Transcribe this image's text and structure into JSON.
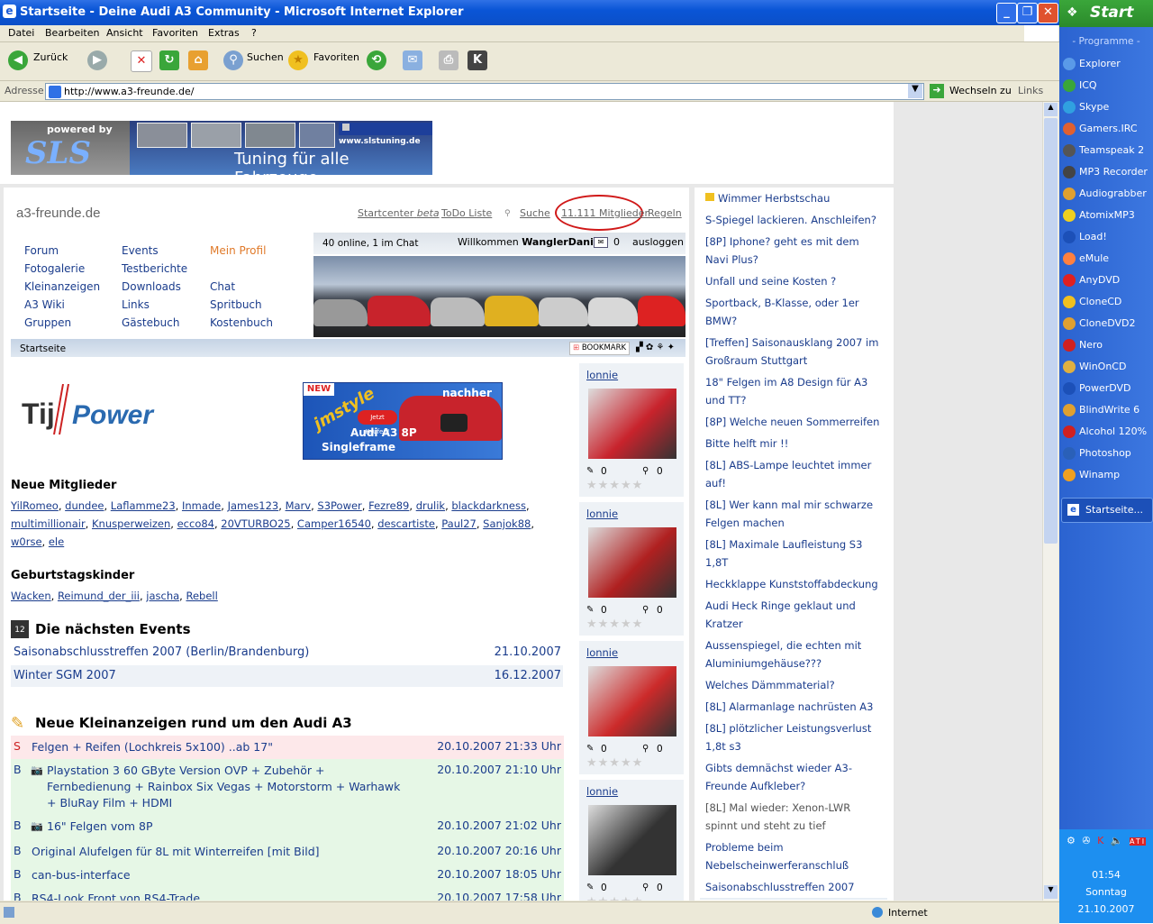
{
  "window": {
    "title": "Startseite - Deine Audi A3 Community - Microsoft Internet Explorer",
    "minimize_label": "_",
    "maximize_label": "❐",
    "close_label": "✕"
  },
  "menubar": [
    "Datei",
    "Bearbeiten",
    "Ansicht",
    "Favoriten",
    "Extras",
    "?"
  ],
  "toolbar": {
    "back_label": "Zurück",
    "search_label": "Suchen",
    "favorites_label": "Favoriten"
  },
  "address": {
    "label": "Adresse",
    "url": "http://www.a3-freunde.de/",
    "go_label": "Wechseln zu",
    "links_label": "Links"
  },
  "banner": {
    "powered_by": "powered by",
    "brand": "SLS",
    "url": "www.slstuning.de",
    "tagline": "Tuning für alle Fahrzeuge"
  },
  "site": {
    "logo": "a3-freunde.de",
    "topnav": {
      "startcenter": "Startcenter",
      "beta": "beta",
      "todo": "ToDo Liste",
      "search": "Suche",
      "members": "11.111 Mitglieder",
      "rules": "Regeln"
    },
    "menu_col1": [
      "Forum",
      "Fotogalerie",
      "Kleinanzeigen",
      "A3 Wiki",
      "Gruppen"
    ],
    "menu_col2": [
      "Events",
      "Testberichte",
      "Downloads",
      "Links",
      "Gästebuch"
    ],
    "menu_col3": [
      "Mein Profil",
      "",
      "Chat",
      "Spritbuch",
      "Kostenbuch"
    ],
    "online": "40 online, 1 im Chat",
    "welcome": "Willkommen",
    "username": "WanglerDaniel",
    "msg_count": "0",
    "logout": "ausloggen",
    "breadcrumb": "Startseite",
    "bookmark": "BOOKMARK"
  },
  "ads": {
    "tijpower": "Tij Power",
    "audi_new": "NEW",
    "audi_style": "jmstyle",
    "audi_buy": "Jetzt Kaufen!",
    "audi_after": "nachher",
    "audi_line1": "Audi A3 8P",
    "audi_line2": "Singleframe"
  },
  "new_members": {
    "heading": "Neue Mitglieder",
    "names": [
      "YilRomeo",
      "dundee",
      "Laflamme23",
      "Inmade",
      "James123",
      "Marv",
      "S3Power",
      "Fezre89",
      "drulik",
      "blackdarkness",
      "multimillionair",
      "Knusperweizen",
      "ecco84",
      "20VTURBO25",
      "Camper16540",
      "descartiste",
      "Paul27",
      "Sanjok88",
      "w0rse",
      "ele"
    ]
  },
  "birthdays": {
    "heading": "Geburtstagskinder",
    "names": [
      "Wacken",
      "Reimund_der_iii",
      "jascha",
      "Rebell"
    ]
  },
  "events": {
    "heading": "Die nächsten Events",
    "icon_text": "12",
    "items": [
      {
        "name": "Saisonabschlusstreffen 2007 (Berlin/Brandenburg)",
        "date": "21.10.2007"
      },
      {
        "name": "Winter SGM 2007",
        "date": "16.12.2007"
      }
    ]
  },
  "classifieds": {
    "heading": "Neue Kleinanzeigen rund um den Audi A3",
    "items": [
      {
        "type": "S",
        "title": "Felgen + Reifen (Lochkreis 5x100) ..ab 17\"",
        "date": "20.10.2007 21:33 Uhr",
        "camera": false
      },
      {
        "type": "B",
        "title": "Playstation 3 60 GByte Version OVP + Zubehör + Fernbedienung + Rainbox Six Vegas + Motorstorm + Warhawk + BluRay Film + HDMI",
        "date": "20.10.2007 21:10 Uhr",
        "camera": true
      },
      {
        "type": "B",
        "title": "16\" Felgen vom 8P",
        "date": "20.10.2007 21:02 Uhr",
        "camera": true
      },
      {
        "type": "B",
        "title": "Original Alufelgen für 8L mit Winterreifen [mit Bild]",
        "date": "20.10.2007 20:16 Uhr",
        "camera": false
      },
      {
        "type": "B",
        "title": "can-bus-interface",
        "date": "20.10.2007 18:05 Uhr",
        "camera": false
      },
      {
        "type": "B",
        "title": "RS4-Look Front von RS4-Trade",
        "date": "20.10.2007 17:58 Uhr",
        "camera": false
      }
    ]
  },
  "gallery": [
    {
      "user": "lonnie",
      "comments": "0",
      "views": "0"
    },
    {
      "user": "lonnie",
      "comments": "0",
      "views": "0"
    },
    {
      "user": "lonnie",
      "comments": "0",
      "views": "0"
    },
    {
      "user": "lonnie",
      "comments": "0",
      "views": "0"
    }
  ],
  "forum_topics": [
    "Wimmer Herbstschau",
    "S-Spiegel lackieren. Anschleifen?",
    "[8P] Iphone? geht es mit dem Navi Plus?",
    "Unfall und seine Kosten ?",
    "Sportback, B-Klasse, oder 1er BMW?",
    "[Treffen] Saisonausklang 2007 im Großraum Stuttgart",
    "18\" Felgen im A8 Design für A3 und TT?",
    "[8P] Welche neuen Sommerreifen",
    "Bitte helft mir !!",
    "[8L] ABS-Lampe leuchtet immer auf!",
    "[8L] Wer kann mal mir schwarze Felgen machen",
    "[8L] Maximale Laufleistung S3 1,8T",
    "Heckklappe Kunststoffabdeckung",
    "Audi Heck Ringe geklaut und Kratzer",
    "Aussenspiegel, die echten mit Aluminiumgehäuse???",
    "Welches Dämmmaterial?",
    "[8L] Alarmanlage nachrüsten A3",
    "[8L] plötzlicher Leistungsverlust 1,8t s3",
    "Gibts demnächst wieder A3-Freunde Aufkleber?",
    "[8L] Mal wieder: Xenon-LWR spinnt und steht zu tief",
    "Probleme beim Nebelscheinwerferanschluß",
    "Saisonabschlusstreffen 2007"
  ],
  "statusbar": {
    "zone": "Internet"
  },
  "startmenu": {
    "start_label": "Start",
    "programs_header": "- Programme -",
    "programs": [
      "Explorer",
      "ICQ",
      "Skype",
      "Gamers.IRC",
      "Teamspeak 2",
      "MP3 Recorder",
      "Audiograbber",
      "AtomixMP3",
      "Load!",
      "eMule",
      "AnyDVD",
      "CloneCD",
      "CloneDVD2",
      "Nero",
      "WinOnCD",
      "PowerDVD",
      "BlindWrite 6",
      "Alcohol 120%",
      "Photoshop",
      "Winamp"
    ],
    "taskbar_item": "Startseite...",
    "clock": "01:54",
    "day": "Sonntag",
    "date": "21.10.2007"
  },
  "colors": {
    "accent": "#1a3c8c",
    "profile": "#e07a2a",
    "highlight": "#e8eef5"
  }
}
